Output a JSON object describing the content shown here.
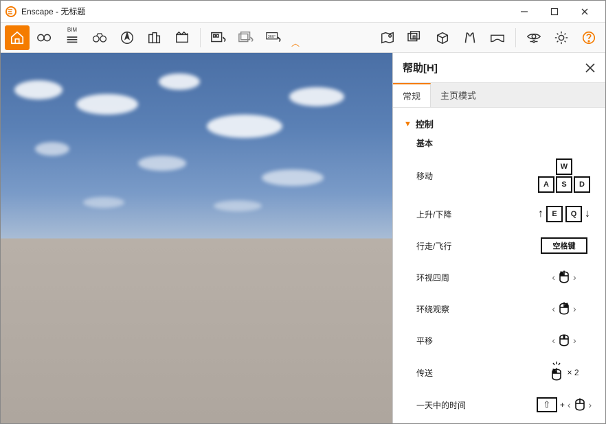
{
  "window": {
    "title": "Enscape - 无标题"
  },
  "help": {
    "title": "帮助[H]",
    "tabs": [
      "常规",
      "主页模式"
    ],
    "section": "控制",
    "sub": "基本",
    "rows": {
      "move": "移动",
      "updown": "上升/下降",
      "walkfly": "行走/飞行",
      "look": "环视四周",
      "orbit": "环绕观察",
      "pan": "平移",
      "teleport": "传送",
      "timeofday": "一天中的时间"
    },
    "keys": {
      "w": "W",
      "a": "A",
      "s": "S",
      "d": "D",
      "e": "E",
      "q": "Q",
      "space": "空格键",
      "x2": " × 2",
      "plus": " + "
    }
  }
}
